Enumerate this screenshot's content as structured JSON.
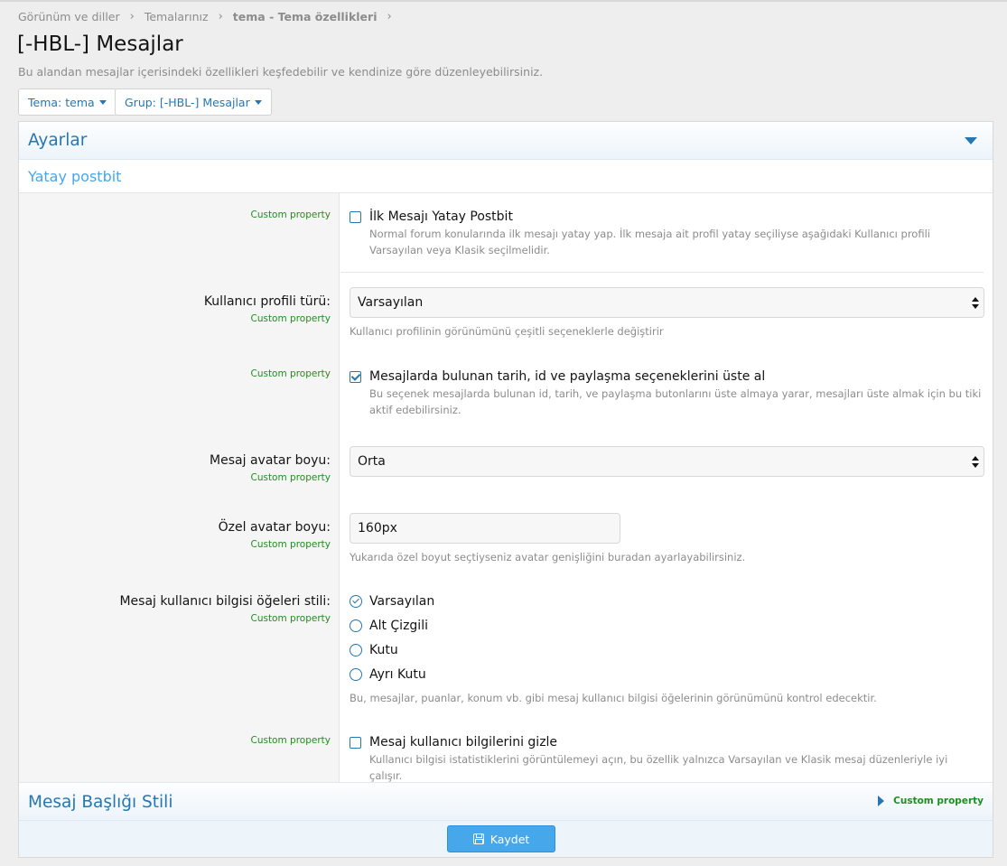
{
  "breadcrumb": {
    "items": [
      "Görünüm ve diller",
      "Temalarınız"
    ],
    "current_strong": "tema",
    "current_suffix": " - Tema özellikleri"
  },
  "page": {
    "title": "[-HBL-] Mesajlar",
    "description": "Bu alandan mesajlar içerisindeki özellikleri keşfedebilir ve kendinize göre düzenleyebilirsiniz."
  },
  "filters": {
    "theme_label": "Tema: tema",
    "group_label": "Grup: [-HBL-] Mesajlar"
  },
  "panel": {
    "title": "Ayarlar",
    "section_title": "Yatay postbit",
    "custom_property": "Custom property"
  },
  "rows": {
    "first_post": {
      "option": "İlk Mesajı Yatay Postbit",
      "checked": false,
      "hint": "Normal forum konularında ilk mesajı yatay yap. İlk mesaja ait profil yatay seçiliyse aşağıdaki Kullanıcı profili Varsayılan veya Klasik seçilmelidir."
    },
    "profile_type": {
      "label": "Kullanıcı profili türü:",
      "value": "Varsayılan",
      "hint": "Kullanıcı profilinin görünümünü çeşitli seçeneklerle değiştirir"
    },
    "post_meta": {
      "option": "Mesajlarda bulunan tarih, id ve paylaşma seçeneklerini üste al",
      "checked": true,
      "hint": "Bu seçenek mesajlarda bulunan id, tarih, ve paylaşma butonlarını üste almaya yarar, mesajları üste almak için bu tiki aktif edebilirsiniz."
    },
    "avatar_size": {
      "label": "Mesaj avatar boyu:",
      "value": "Orta"
    },
    "custom_avatar": {
      "label": "Özel avatar boyu:",
      "value": "160px",
      "hint": "Yukarıda özel boyut seçtiyseniz avatar genişliğini buradan ayarlayabilirsiniz."
    },
    "userinfo_style": {
      "label": "Mesaj kullanıcı bilgisi öğeleri stili:",
      "options": [
        "Varsayılan",
        "Alt Çizgili",
        "Kutu",
        "Ayrı Kutu"
      ],
      "selected": "Varsayılan",
      "hint": "Bu, mesajlar, puanlar, konum vb. gibi mesaj kullanıcı bilgisi öğelerinin görünümünü kontrol edecektir."
    },
    "hide_userinfo": {
      "option": "Mesaj kullanıcı bilgilerini gizle",
      "checked": false,
      "hint": "Kullanıcı bilgisi istatistiklerini görüntülemeyi açın, bu özellik yalnızca Varsayılan ve Klasik mesaj düzenleriyle iyi çalışır."
    }
  },
  "second_panel": {
    "title": "Mesaj Başlığı Stili",
    "custom_property": "Custom property"
  },
  "footer": {
    "save_label": "Kaydet"
  },
  "colors": {
    "link": "#2577b1",
    "accent": "#47a7eb",
    "custom_property": "#1e8f1e"
  }
}
